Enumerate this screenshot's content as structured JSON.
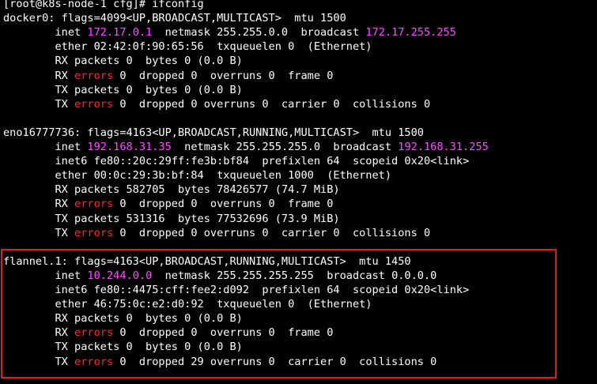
{
  "terminal": {
    "lines": [
      [
        {
          "t": "[root@k8s-node-1 cfg]# ifconfig",
          "c": "white"
        }
      ],
      [
        {
          "t": "docker0: flags=4099<UP,BROADCAST,MULTICAST>  mtu 1500",
          "c": "white"
        }
      ],
      [
        {
          "t": "        inet ",
          "c": "white"
        },
        {
          "t": "172.17.0.1",
          "c": "magenta"
        },
        {
          "t": "  netmask 255.255.0.0  broadcast ",
          "c": "white"
        },
        {
          "t": "172.17.255.255",
          "c": "magenta"
        }
      ],
      [
        {
          "t": "        ether 02:42:0f:90:65:56  txqueuelen 0  (Ethernet)",
          "c": "white"
        }
      ],
      [
        {
          "t": "        RX packets 0  bytes 0 (0.0 B)",
          "c": "white"
        }
      ],
      [
        {
          "t": "        RX ",
          "c": "white"
        },
        {
          "t": "errors",
          "c": "red"
        },
        {
          "t": " 0  dropped 0  overruns 0  frame 0",
          "c": "white"
        }
      ],
      [
        {
          "t": "        TX packets 0  bytes 0 (0.0 B)",
          "c": "white"
        }
      ],
      [
        {
          "t": "        TX ",
          "c": "white"
        },
        {
          "t": "errors",
          "c": "red"
        },
        {
          "t": " 0  dropped 0 overruns 0  carrier 0  collisions 0",
          "c": "white"
        }
      ],
      [
        {
          "t": "",
          "c": "white"
        }
      ],
      [
        {
          "t": "eno16777736: flags=4163<UP,BROADCAST,RUNNING,MULTICAST>  mtu 1500",
          "c": "white"
        }
      ],
      [
        {
          "t": "        inet ",
          "c": "white"
        },
        {
          "t": "192.168.31.35",
          "c": "magenta"
        },
        {
          "t": "  netmask 255.255.255.0  broadcast ",
          "c": "white"
        },
        {
          "t": "192.168.31.255",
          "c": "magenta"
        }
      ],
      [
        {
          "t": "        inet6 fe80::20c:29ff:fe3b:bf84  prefixlen 64  scopeid 0x20<link>",
          "c": "white"
        }
      ],
      [
        {
          "t": "        ether 00:0c:29:3b:bf:84  txqueuelen 1000  (Ethernet)",
          "c": "white"
        }
      ],
      [
        {
          "t": "        RX packets 582705  bytes 78426577 (74.7 MiB)",
          "c": "white"
        }
      ],
      [
        {
          "t": "        RX ",
          "c": "white"
        },
        {
          "t": "errors",
          "c": "red"
        },
        {
          "t": " 0  dropped 0  overruns 0  frame 0",
          "c": "white"
        }
      ],
      [
        {
          "t": "        TX packets 531316  bytes 77532696 (73.9 MiB)",
          "c": "white"
        }
      ],
      [
        {
          "t": "        TX ",
          "c": "white"
        },
        {
          "t": "errors",
          "c": "red"
        },
        {
          "t": " 0  dropped 0 overruns 0  carrier 0  collisions 0",
          "c": "white"
        }
      ],
      [
        {
          "t": "",
          "c": "white"
        }
      ],
      [
        {
          "t": "flannel.1: flags=4163<UP,BROADCAST,RUNNING,MULTICAST>  mtu 1450",
          "c": "white"
        }
      ],
      [
        {
          "t": "        inet ",
          "c": "white"
        },
        {
          "t": "10.244.0.0",
          "c": "magenta"
        },
        {
          "t": "  netmask 255.255.255.255  broadcast 0.0.0.0",
          "c": "white"
        }
      ],
      [
        {
          "t": "        inet6 fe80::4475:cff:fee2:d092  prefixlen 64  scopeid 0x20<link>",
          "c": "white"
        }
      ],
      [
        {
          "t": "        ether 46:75:0c:e2:d0:92  txqueuelen 0  (Ethernet)",
          "c": "white"
        }
      ],
      [
        {
          "t": "        RX packets 0  bytes 0 (0.0 B)",
          "c": "white"
        }
      ],
      [
        {
          "t": "        RX ",
          "c": "white"
        },
        {
          "t": "errors",
          "c": "red"
        },
        {
          "t": " 0  dropped 0  overruns 0  frame 0",
          "c": "white"
        }
      ],
      [
        {
          "t": "        TX packets 0  bytes 0 (0.0 B)",
          "c": "white"
        }
      ],
      [
        {
          "t": "        TX ",
          "c": "white"
        },
        {
          "t": "errors",
          "c": "red"
        },
        {
          "t": " 0  dropped 29 overruns 0  carrier 0  collisions 0",
          "c": "white"
        }
      ]
    ]
  },
  "colors": {
    "background": "#000000",
    "text": "#ffffff",
    "ip_highlight": "#ff4bff",
    "error_highlight": "#ff2a2a",
    "annotation_box": "#e0201a"
  }
}
